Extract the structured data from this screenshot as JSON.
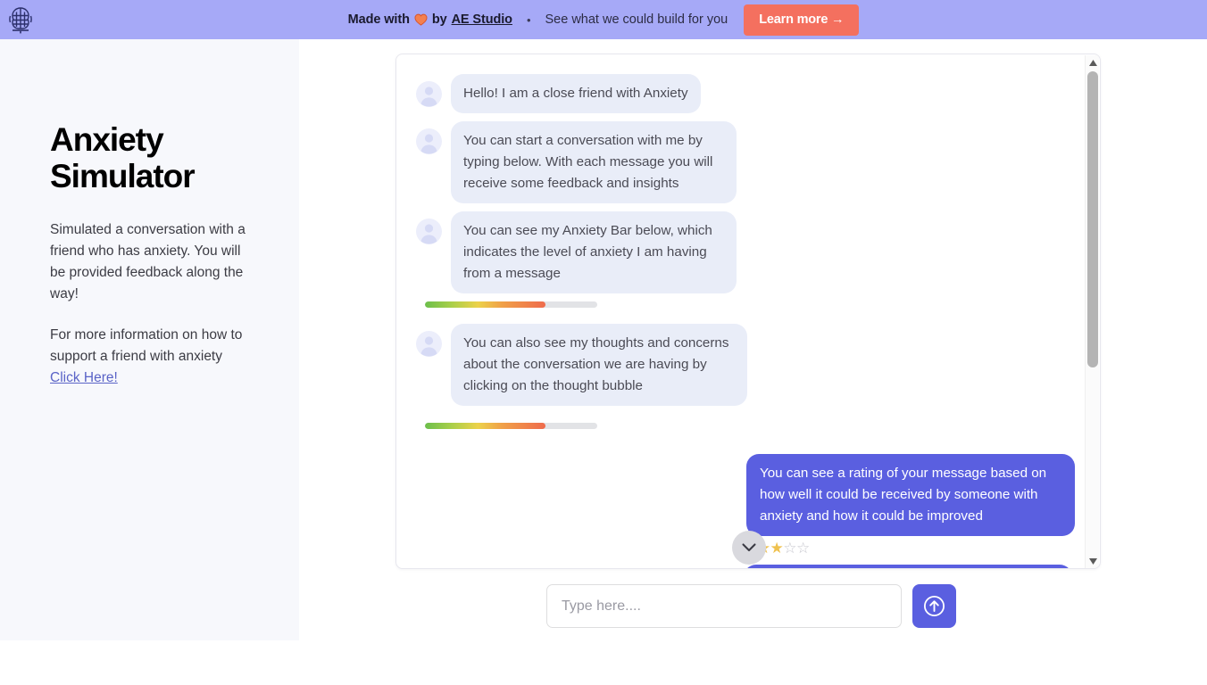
{
  "banner": {
    "logo_icon": "brain-icon",
    "made_with": "Made with",
    "heart_icon": "heart-icon",
    "by": "by",
    "studio_link": "AE Studio",
    "separator": "•",
    "tagline": "See what we could build for you",
    "cta_label": "Learn more →",
    "bg_color": "#a6a9f7",
    "cta_color": "#f4705f"
  },
  "sidebar": {
    "title": "Anxiety Simulator",
    "paragraph1": "Simulated a conversation with a friend who has anxiety. You will be provided feedback along the way!",
    "paragraph2_prefix": "For more information on how to support a friend with anxiety ",
    "link_label": "Click Here!",
    "bg_color": "#f7f8fc"
  },
  "chat": {
    "messages": [
      {
        "sender": "bot",
        "text": "Hello! I am a close friend with Anxiety",
        "avatar_icon": "user-avatar-icon",
        "anxiety_bar": null
      },
      {
        "sender": "bot",
        "text": "You can start a conversation with me by typing below. With each message you will receive some feedback and insights",
        "avatar_icon": "user-avatar-icon",
        "anxiety_bar": null
      },
      {
        "sender": "bot",
        "text": "You can see my Anxiety Bar below, which indicates the level of anxiety I am having from a message",
        "avatar_icon": "user-avatar-icon",
        "anxiety_bar": 70
      },
      {
        "sender": "bot",
        "text": "You can also see my thoughts and concerns about the conversation we are having by clicking on the thought bubble",
        "avatar_icon": "user-avatar-icon",
        "anxiety_bar": 70,
        "thought_icon": "thought-bubble-icon"
      },
      {
        "sender": "user",
        "text": "You can see a rating of your message based on how well it could be received by someone with anxiety and how it could be improved",
        "rating_filled": 3,
        "rating_total": 5
      }
    ],
    "bot_bubble_color": "#e9edf8",
    "user_bubble_color": "#5a5fe0",
    "star_filled_color": "#efc14e",
    "star_empty_color": "#c8c8cf",
    "scroll_down_icon": "chevron-down-icon",
    "scrollbar_up_icon": "triangle-up-icon",
    "scrollbar_down_icon": "triangle-down-icon"
  },
  "composer": {
    "placeholder": "Type here....",
    "value": "",
    "send_icon": "arrow-up-circle-icon",
    "send_color": "#5a5fe0"
  }
}
